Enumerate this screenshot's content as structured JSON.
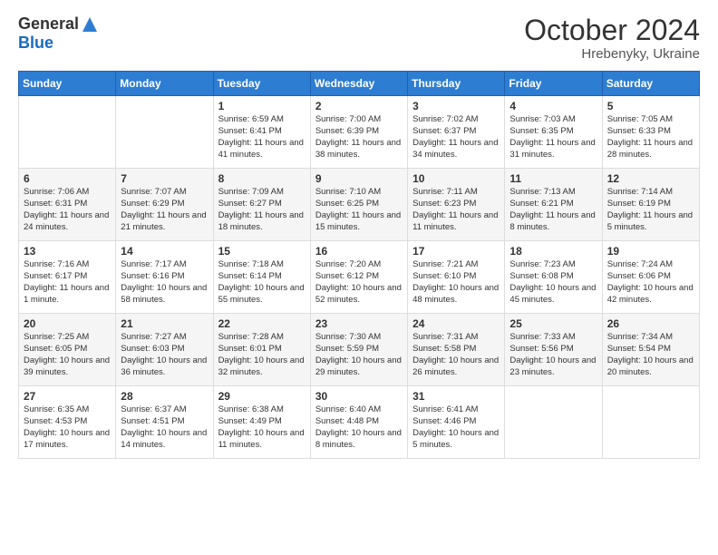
{
  "logo": {
    "general": "General",
    "blue": "Blue"
  },
  "title": "October 2024",
  "subtitle": "Hrebenyky, Ukraine",
  "days_of_week": [
    "Sunday",
    "Monday",
    "Tuesday",
    "Wednesday",
    "Thursday",
    "Friday",
    "Saturday"
  ],
  "weeks": [
    [
      {
        "num": "",
        "sunrise": "",
        "sunset": "",
        "daylight": ""
      },
      {
        "num": "",
        "sunrise": "",
        "sunset": "",
        "daylight": ""
      },
      {
        "num": "1",
        "sunrise": "Sunrise: 6:59 AM",
        "sunset": "Sunset: 6:41 PM",
        "daylight": "Daylight: 11 hours and 41 minutes."
      },
      {
        "num": "2",
        "sunrise": "Sunrise: 7:00 AM",
        "sunset": "Sunset: 6:39 PM",
        "daylight": "Daylight: 11 hours and 38 minutes."
      },
      {
        "num": "3",
        "sunrise": "Sunrise: 7:02 AM",
        "sunset": "Sunset: 6:37 PM",
        "daylight": "Daylight: 11 hours and 34 minutes."
      },
      {
        "num": "4",
        "sunrise": "Sunrise: 7:03 AM",
        "sunset": "Sunset: 6:35 PM",
        "daylight": "Daylight: 11 hours and 31 minutes."
      },
      {
        "num": "5",
        "sunrise": "Sunrise: 7:05 AM",
        "sunset": "Sunset: 6:33 PM",
        "daylight": "Daylight: 11 hours and 28 minutes."
      }
    ],
    [
      {
        "num": "6",
        "sunrise": "Sunrise: 7:06 AM",
        "sunset": "Sunset: 6:31 PM",
        "daylight": "Daylight: 11 hours and 24 minutes."
      },
      {
        "num": "7",
        "sunrise": "Sunrise: 7:07 AM",
        "sunset": "Sunset: 6:29 PM",
        "daylight": "Daylight: 11 hours and 21 minutes."
      },
      {
        "num": "8",
        "sunrise": "Sunrise: 7:09 AM",
        "sunset": "Sunset: 6:27 PM",
        "daylight": "Daylight: 11 hours and 18 minutes."
      },
      {
        "num": "9",
        "sunrise": "Sunrise: 7:10 AM",
        "sunset": "Sunset: 6:25 PM",
        "daylight": "Daylight: 11 hours and 15 minutes."
      },
      {
        "num": "10",
        "sunrise": "Sunrise: 7:11 AM",
        "sunset": "Sunset: 6:23 PM",
        "daylight": "Daylight: 11 hours and 11 minutes."
      },
      {
        "num": "11",
        "sunrise": "Sunrise: 7:13 AM",
        "sunset": "Sunset: 6:21 PM",
        "daylight": "Daylight: 11 hours and 8 minutes."
      },
      {
        "num": "12",
        "sunrise": "Sunrise: 7:14 AM",
        "sunset": "Sunset: 6:19 PM",
        "daylight": "Daylight: 11 hours and 5 minutes."
      }
    ],
    [
      {
        "num": "13",
        "sunrise": "Sunrise: 7:16 AM",
        "sunset": "Sunset: 6:17 PM",
        "daylight": "Daylight: 11 hours and 1 minute."
      },
      {
        "num": "14",
        "sunrise": "Sunrise: 7:17 AM",
        "sunset": "Sunset: 6:16 PM",
        "daylight": "Daylight: 10 hours and 58 minutes."
      },
      {
        "num": "15",
        "sunrise": "Sunrise: 7:18 AM",
        "sunset": "Sunset: 6:14 PM",
        "daylight": "Daylight: 10 hours and 55 minutes."
      },
      {
        "num": "16",
        "sunrise": "Sunrise: 7:20 AM",
        "sunset": "Sunset: 6:12 PM",
        "daylight": "Daylight: 10 hours and 52 minutes."
      },
      {
        "num": "17",
        "sunrise": "Sunrise: 7:21 AM",
        "sunset": "Sunset: 6:10 PM",
        "daylight": "Daylight: 10 hours and 48 minutes."
      },
      {
        "num": "18",
        "sunrise": "Sunrise: 7:23 AM",
        "sunset": "Sunset: 6:08 PM",
        "daylight": "Daylight: 10 hours and 45 minutes."
      },
      {
        "num": "19",
        "sunrise": "Sunrise: 7:24 AM",
        "sunset": "Sunset: 6:06 PM",
        "daylight": "Daylight: 10 hours and 42 minutes."
      }
    ],
    [
      {
        "num": "20",
        "sunrise": "Sunrise: 7:25 AM",
        "sunset": "Sunset: 6:05 PM",
        "daylight": "Daylight: 10 hours and 39 minutes."
      },
      {
        "num": "21",
        "sunrise": "Sunrise: 7:27 AM",
        "sunset": "Sunset: 6:03 PM",
        "daylight": "Daylight: 10 hours and 36 minutes."
      },
      {
        "num": "22",
        "sunrise": "Sunrise: 7:28 AM",
        "sunset": "Sunset: 6:01 PM",
        "daylight": "Daylight: 10 hours and 32 minutes."
      },
      {
        "num": "23",
        "sunrise": "Sunrise: 7:30 AM",
        "sunset": "Sunset: 5:59 PM",
        "daylight": "Daylight: 10 hours and 29 minutes."
      },
      {
        "num": "24",
        "sunrise": "Sunrise: 7:31 AM",
        "sunset": "Sunset: 5:58 PM",
        "daylight": "Daylight: 10 hours and 26 minutes."
      },
      {
        "num": "25",
        "sunrise": "Sunrise: 7:33 AM",
        "sunset": "Sunset: 5:56 PM",
        "daylight": "Daylight: 10 hours and 23 minutes."
      },
      {
        "num": "26",
        "sunrise": "Sunrise: 7:34 AM",
        "sunset": "Sunset: 5:54 PM",
        "daylight": "Daylight: 10 hours and 20 minutes."
      }
    ],
    [
      {
        "num": "27",
        "sunrise": "Sunrise: 6:35 AM",
        "sunset": "Sunset: 4:53 PM",
        "daylight": "Daylight: 10 hours and 17 minutes."
      },
      {
        "num": "28",
        "sunrise": "Sunrise: 6:37 AM",
        "sunset": "Sunset: 4:51 PM",
        "daylight": "Daylight: 10 hours and 14 minutes."
      },
      {
        "num": "29",
        "sunrise": "Sunrise: 6:38 AM",
        "sunset": "Sunset: 4:49 PM",
        "daylight": "Daylight: 10 hours and 11 minutes."
      },
      {
        "num": "30",
        "sunrise": "Sunrise: 6:40 AM",
        "sunset": "Sunset: 4:48 PM",
        "daylight": "Daylight: 10 hours and 8 minutes."
      },
      {
        "num": "31",
        "sunrise": "Sunrise: 6:41 AM",
        "sunset": "Sunset: 4:46 PM",
        "daylight": "Daylight: 10 hours and 5 minutes."
      },
      {
        "num": "",
        "sunrise": "",
        "sunset": "",
        "daylight": ""
      },
      {
        "num": "",
        "sunrise": "",
        "sunset": "",
        "daylight": ""
      }
    ]
  ]
}
